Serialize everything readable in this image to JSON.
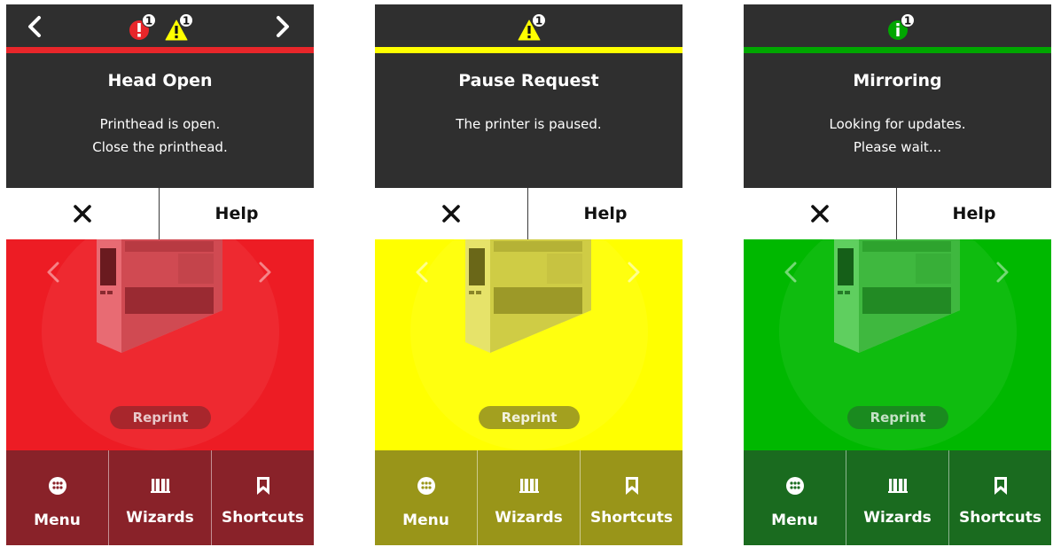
{
  "colors": {
    "dark": "#2f2f2f",
    "error_rule": "#e8262a",
    "error_bg": "#ed1c24",
    "error_dark": "#892229",
    "warning_rule": "#ffff00",
    "warning_bg": "#ffff00",
    "warning_dark": "#999519",
    "info_rule": "#00a600",
    "info_bg": "#00b800",
    "info_dark": "#1a6b1f"
  },
  "panels": [
    {
      "state": "error",
      "alert_badges": [
        {
          "icon": "error-alert-icon",
          "count": "1"
        },
        {
          "icon": "warning-alert-icon",
          "count": "1"
        }
      ],
      "title": "Head Open",
      "message": [
        "Printhead is open.",
        "Close the printhead."
      ],
      "close_icon": "close-icon",
      "help_label": "Help",
      "reprint_label": "Reprint",
      "tiles": [
        {
          "icon": "menu-dots-icon",
          "label": "Menu"
        },
        {
          "icon": "book-icon",
          "label": "Wizards"
        },
        {
          "icon": "bookmark-icon",
          "label": "Shortcuts"
        }
      ]
    },
    {
      "state": "warning",
      "alert_badges": [
        {
          "icon": "warning-alert-icon",
          "count": "1"
        }
      ],
      "title": "Pause Request",
      "message": [
        "The printer is paused."
      ],
      "close_icon": "close-icon",
      "help_label": "Help",
      "reprint_label": "Reprint",
      "tiles": [
        {
          "icon": "menu-dots-icon",
          "label": "Menu"
        },
        {
          "icon": "book-icon",
          "label": "Wizards"
        },
        {
          "icon": "bookmark-icon",
          "label": "Shortcuts"
        }
      ]
    },
    {
      "state": "info",
      "alert_badges": [
        {
          "icon": "info-alert-icon",
          "count": "1"
        }
      ],
      "title": "Mirroring",
      "message": [
        "Looking for updates.",
        "Please wait..."
      ],
      "close_icon": "close-icon",
      "help_label": "Help",
      "reprint_label": "Reprint",
      "tiles": [
        {
          "icon": "menu-dots-icon",
          "label": "Menu"
        },
        {
          "icon": "book-icon",
          "label": "Wizards"
        },
        {
          "icon": "bookmark-icon",
          "label": "Shortcuts"
        }
      ]
    }
  ]
}
